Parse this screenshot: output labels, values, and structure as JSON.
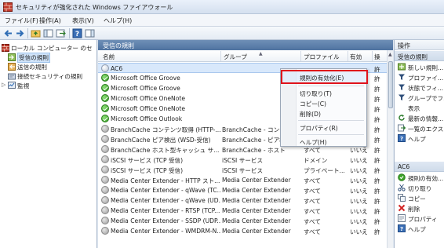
{
  "window": {
    "title": "セキュリティが強化された Windows ファイアウォール"
  },
  "menu": [
    "ファイル(F)",
    "操作(A)",
    "表示(V)",
    "ヘルプ(H)"
  ],
  "tree": {
    "root": "ローカル コンピューター のセ",
    "items": [
      "受信の規則",
      "送信の規則",
      "接続セキュリティの規則",
      "監視"
    ]
  },
  "center": {
    "header": "受信の規則",
    "columns": [
      "名前",
      "グループ",
      "プロファイル",
      "有効",
      "操"
    ],
    "rows": [
      {
        "name": "AC6",
        "group": "",
        "profile": "",
        "enabled": "",
        "op": "許",
        "state": "sel"
      },
      {
        "name": "Microsoft Office Groove",
        "group": "",
        "profile": "",
        "enabled": "",
        "op": "許",
        "state": "on"
      },
      {
        "name": "Microsoft Office Groove",
        "group": "",
        "profile": "",
        "enabled": "",
        "op": "許",
        "state": "on"
      },
      {
        "name": "Microsoft Office OneNote",
        "group": "",
        "profile": "",
        "enabled": "",
        "op": "許",
        "state": "on"
      },
      {
        "name": "Microsoft Office OneNote",
        "group": "",
        "profile": "",
        "enabled": "",
        "op": "許",
        "state": "on"
      },
      {
        "name": "Microsoft Office Outlook",
        "group": "",
        "profile": "",
        "enabled": "",
        "op": "許",
        "state": "on"
      },
      {
        "name": "BranchCache コンテンツ取得 (HTTP-...",
        "group": "BranchCache - コンテ",
        "profile": "",
        "enabled": "",
        "op": "許",
        "state": "off"
      },
      {
        "name": "BranchCache ピア検出 (WSD-受信)",
        "group": "BranchCache - ピア検",
        "profile": "",
        "enabled": "",
        "op": "許",
        "state": "off"
      },
      {
        "name": "BranchCache ホスト型キャッシュ サ...",
        "group": "BranchCache - ホスト",
        "profile": "すべて",
        "enabled": "いいえ",
        "op": "許",
        "state": "off"
      },
      {
        "name": "iSCSI サービス (TCP 受信)",
        "group": "iSCSI サービス",
        "profile": "ドメイン",
        "enabled": "いいえ",
        "op": "許",
        "state": "off"
      },
      {
        "name": "iSCSI サービス (TCP 受信)",
        "group": "iSCSI サービス",
        "profile": "プライベート...",
        "enabled": "いいえ",
        "op": "許",
        "state": "off"
      },
      {
        "name": "Media Center Extender - HTTP スト...",
        "group": "Media Center Extender",
        "profile": "すべて",
        "enabled": "いいえ",
        "op": "許",
        "state": "off"
      },
      {
        "name": "Media Center Extender - qWave (TC...",
        "group": "Media Center Extender",
        "profile": "すべて",
        "enabled": "いいえ",
        "op": "許",
        "state": "off"
      },
      {
        "name": "Media Center Extender - qWave (UD...",
        "group": "Media Center Extender",
        "profile": "すべて",
        "enabled": "いいえ",
        "op": "許",
        "state": "off"
      },
      {
        "name": "Media Center Extender - RTSP (TCP...",
        "group": "Media Center Extender",
        "profile": "すべて",
        "enabled": "いいえ",
        "op": "許",
        "state": "off"
      },
      {
        "name": "Media Center Extender - SSDP (UDP...",
        "group": "Media Center Extender",
        "profile": "すべて",
        "enabled": "いいえ",
        "op": "許",
        "state": "off"
      },
      {
        "name": "Media Center Extender - WMDRM-N...",
        "group": "Media Center Extender",
        "profile": "すべて",
        "enabled": "いいえ",
        "op": "許",
        "state": "off"
      }
    ]
  },
  "context_menu": {
    "items": [
      "規則の有効化(E)",
      "切り取り(T)",
      "コピー(C)",
      "削除(D)",
      "プロパティ(R)",
      "ヘルプ(H)"
    ]
  },
  "actions": {
    "header": "操作",
    "section1": "受信の規則",
    "items1": [
      "新しい規則...",
      "プロファイ...",
      "状態でフィ...",
      "グループでフ...",
      "表示",
      "最新の情報...",
      "一覧のエクス...",
      "ヘルプ"
    ],
    "section2": "AC6",
    "items2": [
      "規則の有効...",
      "切り取り",
      "コピー",
      "削除",
      "プロパティ",
      "ヘルプ"
    ]
  }
}
